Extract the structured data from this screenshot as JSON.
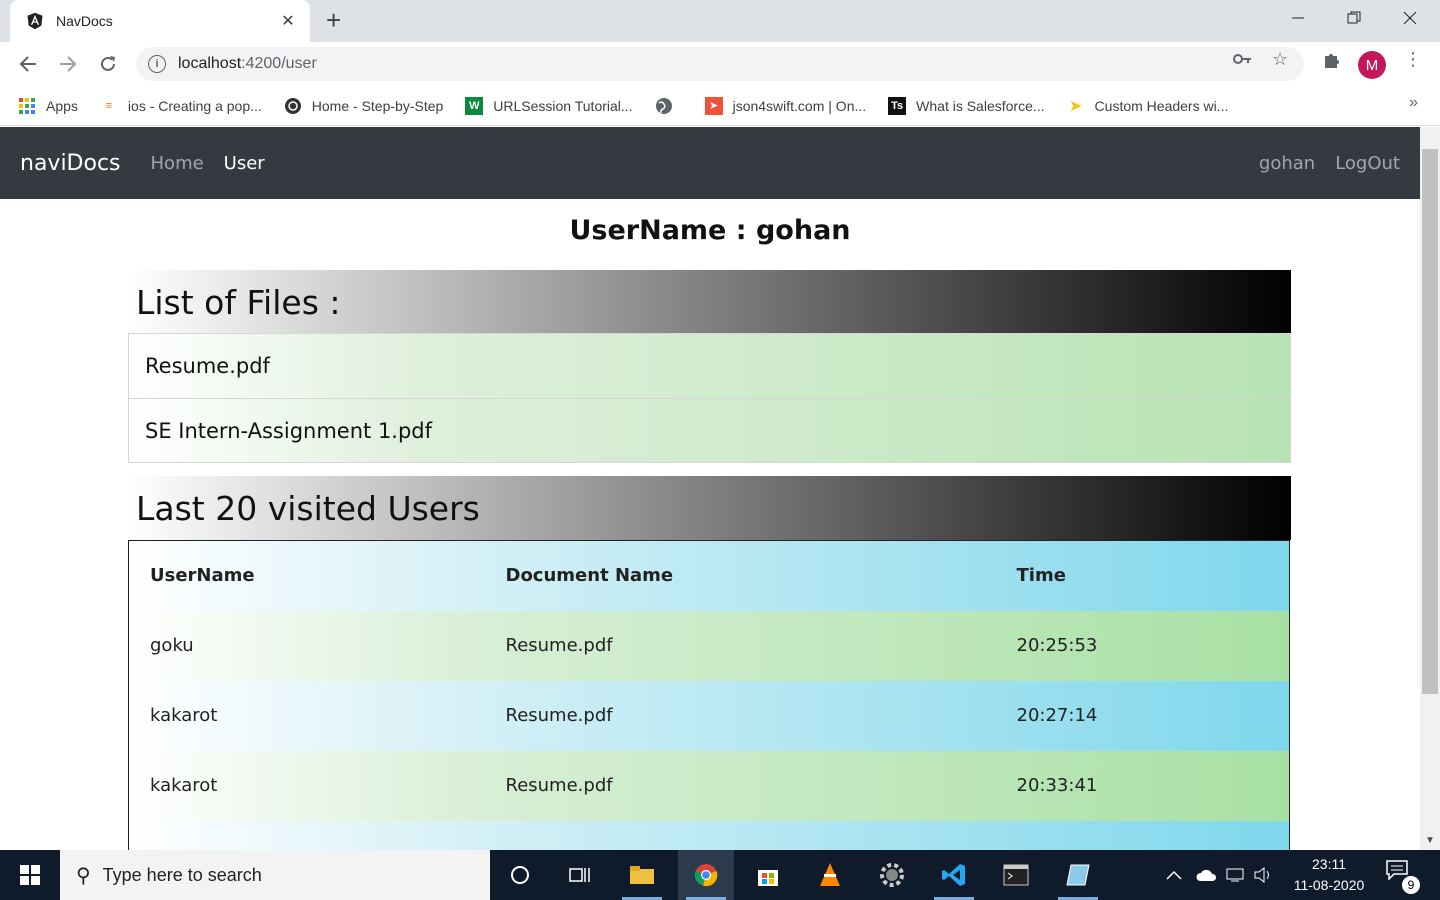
{
  "browser": {
    "tab_title": "NavDocs",
    "url_host": "localhost",
    "url_path": ":4200/user",
    "bookmarks": [
      {
        "label": "Apps"
      },
      {
        "label": "ios - Creating a pop..."
      },
      {
        "label": "Home - Step-by-Step"
      },
      {
        "label": "URLSession Tutorial..."
      },
      {
        "label": ""
      },
      {
        "label": "json4swift.com | On..."
      },
      {
        "label": "What is Salesforce..."
      },
      {
        "label": "Custom Headers wi..."
      }
    ],
    "profile_initial": "M"
  },
  "navbar": {
    "brand": "naviDocs",
    "links": [
      "Home",
      "User"
    ],
    "active": "User",
    "right_links": [
      "gohan",
      "LogOut"
    ]
  },
  "page": {
    "title": "UserName : gohan",
    "files_heading": "List of Files :",
    "files": [
      "Resume.pdf",
      "SE Intern-Assignment 1.pdf"
    ],
    "users_heading": "Last 20 visited Users",
    "table": {
      "headers": [
        "UserName",
        "Document Name",
        "Time"
      ],
      "rows": [
        [
          "goku",
          "Resume.pdf",
          "20:25:53"
        ],
        [
          "kakarot",
          "Resume.pdf",
          "20:27:14"
        ],
        [
          "kakarot",
          "Resume.pdf",
          "20:33:41"
        ]
      ]
    }
  },
  "taskbar": {
    "search_placeholder": "Type here to search",
    "time": "23:11",
    "date": "11-08-2020",
    "notification_count": "9"
  }
}
